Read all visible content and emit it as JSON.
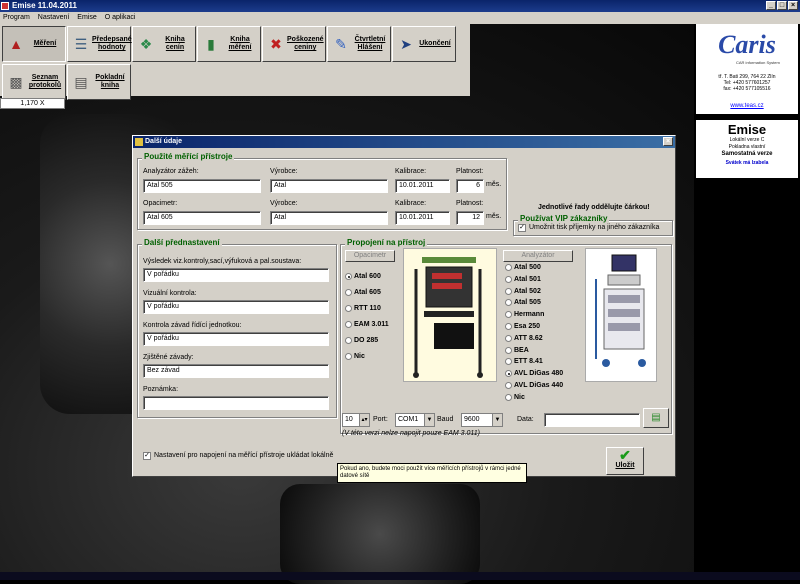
{
  "window": {
    "title": "Emise 11.04.2011",
    "minimize": "_",
    "maximize": "□",
    "close": "×"
  },
  "menu": [
    "Program",
    "Nastavení",
    "Emise",
    "O aplikaci"
  ],
  "toolbar": {
    "buttons": [
      {
        "label": "Měření",
        "icon": "car-icon"
      },
      {
        "label": "Předepsané hodnoty",
        "icon": "list-check-icon"
      },
      {
        "label": "Kniha cenín",
        "icon": "book-icon"
      },
      {
        "label": "Kniha měření",
        "icon": "notebook-icon"
      },
      {
        "label": "Poškozené ceniny",
        "icon": "damaged-icon"
      },
      {
        "label": "Čtvrtletní Hlášení",
        "icon": "chart-icon"
      },
      {
        "label": "Ukončení",
        "icon": "exit-icon"
      },
      {
        "label": "Seznam protokolů",
        "icon": "printer-icon"
      },
      {
        "label": "Pokladní kniha",
        "icon": "cash-icon"
      }
    ],
    "zoom": "1,170 X"
  },
  "brand": {
    "logo": "Caris",
    "logo_sub": "CAR information System",
    "address": [
      "tř. T. Bati 299, 764 22 Zlín",
      "Tel: +420 577601257",
      "fax: +420 577105516"
    ],
    "url": "www.teas.cz"
  },
  "edition": {
    "title": "Emise",
    "lines": [
      "Lokální verze C",
      "Pokladna vlastní"
    ],
    "bold": "Samostatná verze",
    "subtitle": "Svátek má Izabela"
  },
  "dialog": {
    "title": "Další údaje",
    "instruments": {
      "title": "Použité měřící přístroje",
      "analyzer_label": "Analyzátor  zážeh:",
      "analyzer_value": "Atal 505",
      "manufacturer_label": "Výrobce:",
      "manufacturer_value": "Atal",
      "calibration_label": "Kalibrace:",
      "calibration_value": "10.01.2011",
      "validity_label": "Platnost:",
      "validity_value": "6",
      "months": "měs.",
      "opacimeter_label": "Opacimetr:",
      "opacimeter_value": "Atal 605",
      "manufacturer2_value": "Atal",
      "calibration2_value": "10.01.2011",
      "validity2_value": "12",
      "note": "Jednotlivé řady oddělujte čárkou!"
    },
    "vip": {
      "title": "Používat VIP zákazníky",
      "checkbox_label": "Umožnit tisk příjemky na jiného zákazníka",
      "checked": true
    },
    "settings": {
      "title": "Další přednastavení",
      "result_label": "Výsledek viz.kontroly,sací,výfuková a pal.soustava:",
      "result_value": "V pořádku",
      "visual_label": "Vizuální kontrola:",
      "visual_value": "V pořádku",
      "fault_label": "Kontrola závad řídící jednotkou:",
      "fault_value": "V pořádku",
      "found_label": "Zjištěné závady:",
      "found_value": "Bez závad",
      "note_label": "Poznámka:",
      "note_value": ""
    },
    "connection": {
      "title": "Propojení na přístroj",
      "opacimeter_button": "Opacimetr",
      "opacimeter_options": [
        "Atal 600",
        "Atal 605",
        "RTT 110",
        "EAM 3.011",
        "DO 285",
        "Nic"
      ],
      "opacimeter_selected": 0,
      "analyzer_button": "Analyzátor",
      "analyzer_options": [
        "Atal 500",
        "Atal 501",
        "Atal 502",
        "Atal 505",
        "Hermann",
        "Esa 250",
        "ATT 8.62",
        "BEA",
        "ETT 8.41",
        "AVL DiGas 480",
        "AVL DiGas 440",
        "Nic"
      ],
      "analyzer_selected": 9,
      "timeout_value": "10",
      "port_label": "Port:",
      "port_value": "COM1",
      "baud_label": "Baud",
      "baud_value": "9600",
      "data_label": "Data:",
      "data_value": "",
      "eam_note": "(V této verzi nelze napojit pouze EAM 3.011)"
    },
    "save_settings_label": "Nastavení pro napojení na měřící přístroje ukládat lokálně",
    "save_settings_checked": true,
    "save_button": "Uložit"
  },
  "tooltip": "Pokud ano, budete moci použít více měřících přístrojů v rámci jedné datové sítě"
}
